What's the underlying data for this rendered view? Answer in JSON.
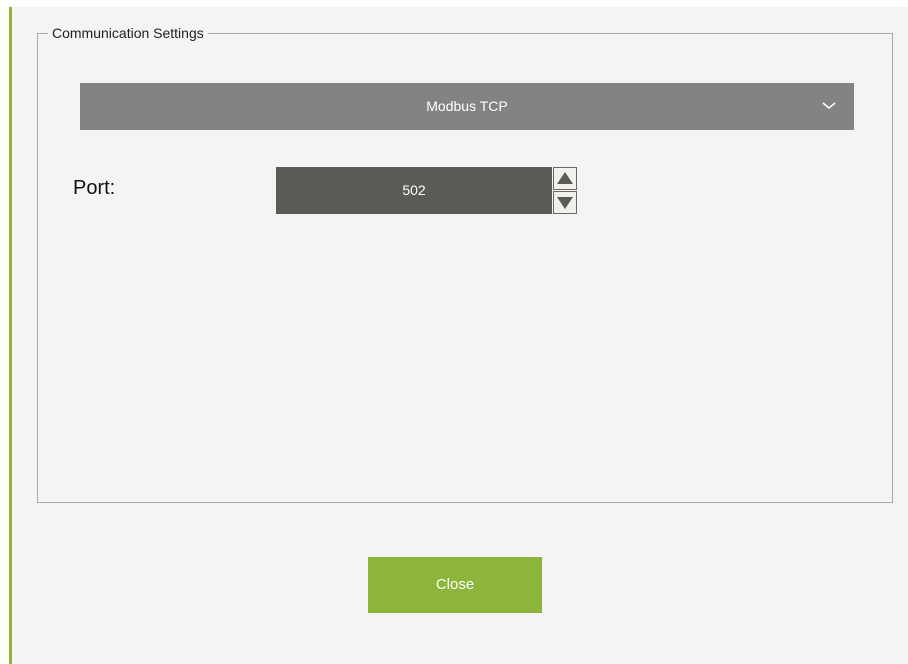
{
  "dialog": {
    "accent_color": "#8db53c"
  },
  "communication": {
    "group_title": "Communication Settings",
    "protocol": {
      "selected": "Modbus TCP",
      "icon": "chevron-down-icon"
    },
    "port": {
      "label": "Port:",
      "value": "502",
      "up_icon": "triangle-up-icon",
      "down_icon": "triangle-down-icon"
    }
  },
  "footer": {
    "close_label": "Close"
  }
}
